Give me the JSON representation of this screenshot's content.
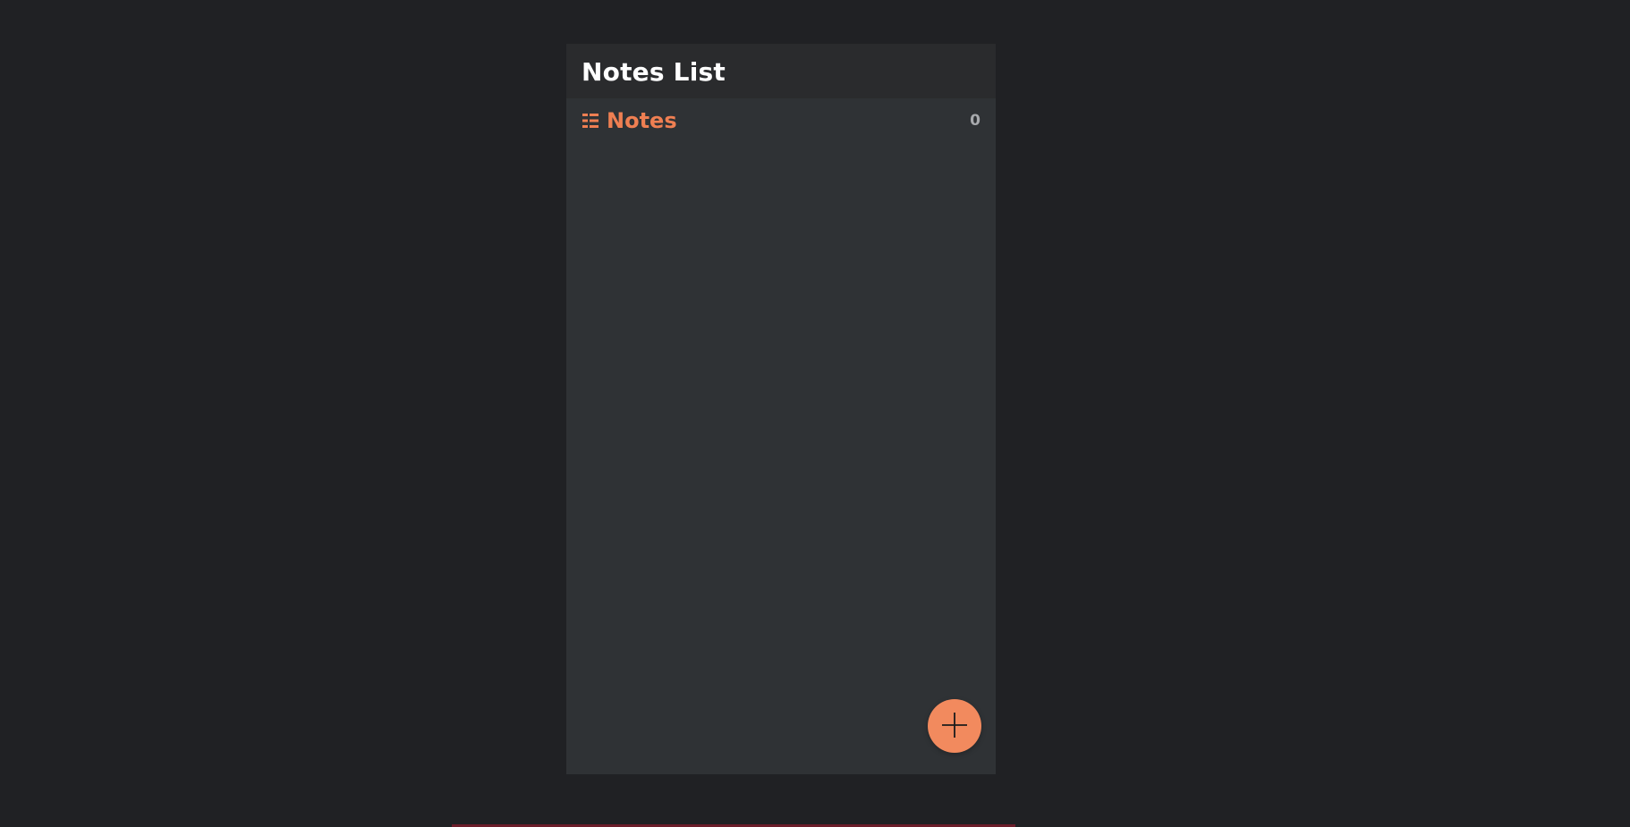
{
  "app": {
    "title": "Notes List"
  },
  "notes_section": {
    "label": "Notes",
    "count": "0",
    "icon": "list-icon"
  },
  "fab": {
    "icon": "plus-icon"
  },
  "colors": {
    "background": "#202124",
    "panel": "#2f3235",
    "header": "#2a2b2d",
    "accent": "#ef7f52",
    "fab": "#f28a5e",
    "muted": "#a8aaad"
  }
}
